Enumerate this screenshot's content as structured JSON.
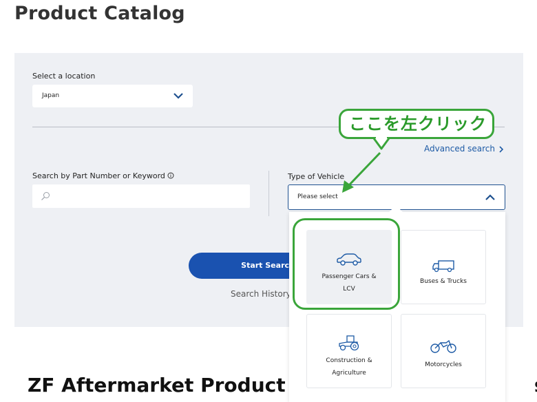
{
  "page": {
    "title": "Product Catalog",
    "bottom_title": "ZF Aftermarket Product R",
    "bottom_title_tail": "s"
  },
  "location": {
    "label": "Select a location",
    "value": "Japan"
  },
  "advanced_search": {
    "label": "Advanced search"
  },
  "keyword_search": {
    "label": "Search by Part Number or Keyword",
    "placeholder": ""
  },
  "vehicle_type": {
    "label": "Type of Vehicle",
    "placeholder": "Please select",
    "options": [
      {
        "label_line1": "Passenger Cars &",
        "label_line2": "LCV",
        "icon": "car-icon",
        "selected": true
      },
      {
        "label_line1": "Buses & Trucks",
        "label_line2": "",
        "icon": "truck-icon",
        "selected": false
      },
      {
        "label_line1": "Construction &",
        "label_line2": "Agriculture",
        "icon": "tractor-icon",
        "selected": false
      },
      {
        "label_line1": "Motorcycles",
        "label_line2": "",
        "icon": "motorcycle-icon",
        "selected": false
      }
    ]
  },
  "actions": {
    "start_search": "Start Search",
    "history": "Search History"
  },
  "annotation": {
    "text": "ここを左クリック",
    "color": "#3aa53a"
  },
  "colors": {
    "accent": "#1a52b0",
    "link": "#1d5aa5",
    "panel": "#eef0f4"
  }
}
